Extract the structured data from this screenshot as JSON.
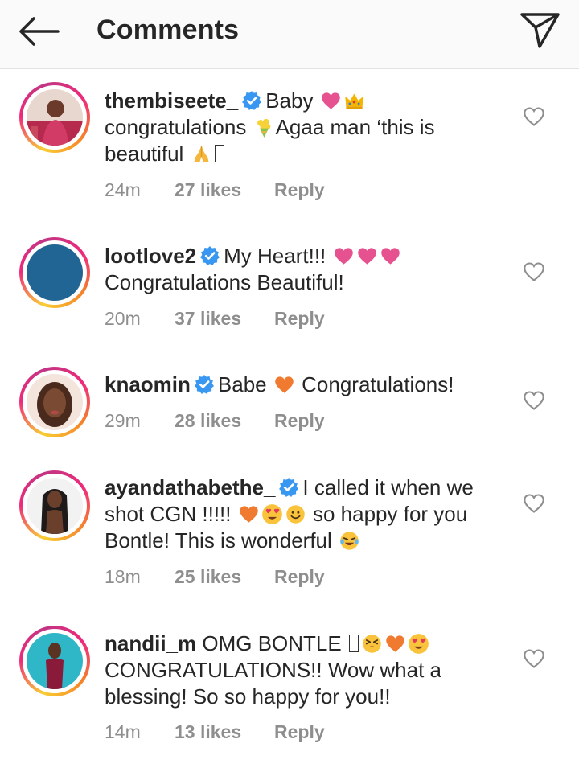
{
  "header": {
    "title": "Comments",
    "back_icon": "arrow-left-icon",
    "send_icon": "paper-plane-icon"
  },
  "colors": {
    "verified": "#3897f0",
    "meta": "#8e8e8e",
    "text": "#262626"
  },
  "comments": [
    {
      "username": "thembiseete_",
      "line1_a": "Baby",
      "line2_a": "congratulations",
      "line2_b": "Agaa man ‘this is",
      "line3_a": "beautiful",
      "time": "24m",
      "likes": "27 likes",
      "reply": "Reply"
    },
    {
      "username": "lootlove2",
      "line1_a": "My Heart!!!",
      "line2_a": "Congratulations Beautiful!",
      "time": "20m",
      "likes": "37 likes",
      "reply": "Reply"
    },
    {
      "username": "knaomin",
      "line1_a": "Babe",
      "line1_b": "Congratulations!",
      "time": "29m",
      "likes": "28 likes",
      "reply": "Reply"
    },
    {
      "username": "ayandathabethe_",
      "line1_a": "I called it when we",
      "line2_a": "shot CGN !!!!!",
      "line2_b": "so happy for you",
      "line3_a": "Bontle! This is wonderful",
      "time": "18m",
      "likes": "25 likes",
      "reply": "Reply"
    },
    {
      "username": "nandii_m",
      "line1_a": "OMG BONTLE",
      "line2_a": "CONGRATULATIONS!! Wow what a",
      "line3_a": "blessing! So so happy for you!!",
      "time": "14m",
      "likes": "13 likes",
      "reply": "Reply"
    }
  ]
}
